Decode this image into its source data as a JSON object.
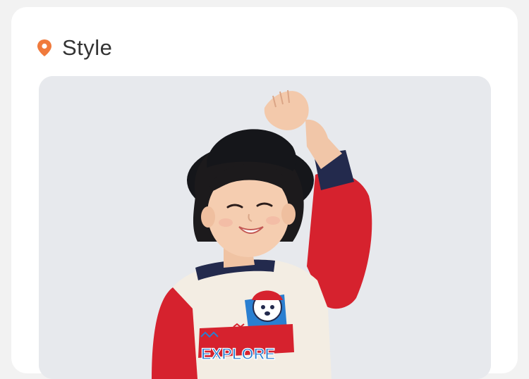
{
  "section": {
    "title": "Style",
    "icon": "location-pin-icon",
    "accent_color": "#f07a3c"
  },
  "photo": {
    "alt": "",
    "print_text": "EXPLORE",
    "colors": {
      "background": "#e7e9ed",
      "sleeve_red": "#d6222e",
      "body_cream": "#f3ede3",
      "collar_navy": "#232a4d",
      "hat_black": "#15161a",
      "print_blue": "#2a7fd1"
    }
  }
}
